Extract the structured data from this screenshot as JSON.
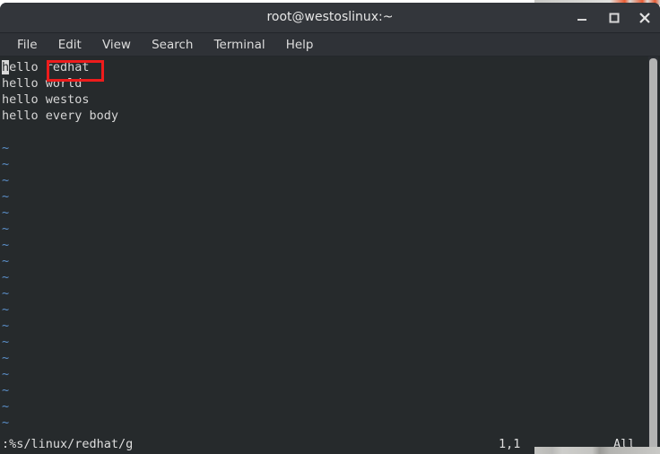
{
  "window": {
    "title": "root@westoslinux:~",
    "controls": {
      "minimize": "minimize-button",
      "maximize": "maximize-button",
      "close": "close-button"
    },
    "colors": {
      "titlebar_bg": "#33363b",
      "menubar_bg": "#2f3237",
      "terminal_bg": "#262a2c",
      "text": "#d6d6d6",
      "tilde": "#5b8fc9",
      "annotation": "#ee1c1c",
      "scrollbar": "#b3b3b3"
    }
  },
  "menubar": {
    "items": [
      {
        "label": "File"
      },
      {
        "label": "Edit"
      },
      {
        "label": "View"
      },
      {
        "label": "Search"
      },
      {
        "label": "Terminal"
      },
      {
        "label": "Help"
      }
    ]
  },
  "editor": {
    "app": "vim",
    "cursor_char": "h",
    "lines": [
      {
        "text": "ello redhat",
        "type": "content"
      },
      {
        "text": "hello world",
        "type": "content"
      },
      {
        "text": "hello westos",
        "type": "content"
      },
      {
        "text": "hello every body",
        "type": "content"
      },
      {
        "text": "",
        "type": "blank"
      },
      {
        "text": "~",
        "type": "tilde"
      },
      {
        "text": "~",
        "type": "tilde"
      },
      {
        "text": "~",
        "type": "tilde"
      },
      {
        "text": "~",
        "type": "tilde"
      },
      {
        "text": "~",
        "type": "tilde"
      },
      {
        "text": "~",
        "type": "tilde"
      },
      {
        "text": "~",
        "type": "tilde"
      },
      {
        "text": "~",
        "type": "tilde"
      },
      {
        "text": "~",
        "type": "tilde"
      },
      {
        "text": "~",
        "type": "tilde"
      },
      {
        "text": "~",
        "type": "tilde"
      },
      {
        "text": "~",
        "type": "tilde"
      },
      {
        "text": "~",
        "type": "tilde"
      },
      {
        "text": "~",
        "type": "tilde"
      },
      {
        "text": "~",
        "type": "tilde"
      },
      {
        "text": "~",
        "type": "tilde"
      },
      {
        "text": "~",
        "type": "tilde"
      },
      {
        "text": "~",
        "type": "tilde"
      }
    ]
  },
  "statusline": {
    "command": ":%s/linux/redhat/g",
    "position": "1,1",
    "scroll": "All"
  },
  "annotation": {
    "label": "redhat",
    "shape": "rectangle",
    "color": "#ee1c1c"
  }
}
